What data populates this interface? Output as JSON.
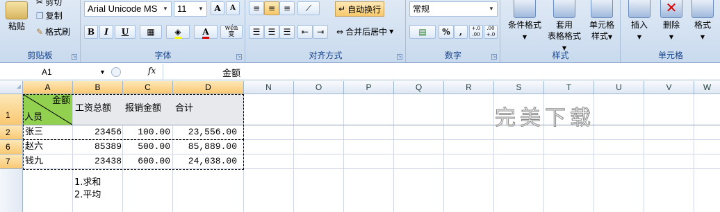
{
  "ribbon": {
    "clipboard": {
      "paste": "粘贴",
      "cut": "剪切",
      "copy": "复制",
      "format_painter": "格式刷",
      "label": "剪贴板"
    },
    "font": {
      "font_name": "Arial Unicode MS",
      "font_size": "11",
      "grow": "A",
      "shrink": "A",
      "bold": "B",
      "italic": "I",
      "underline": "U",
      "font_color_letter": "A",
      "phonetic": "wén",
      "phonetic_char": "变",
      "label": "字体"
    },
    "alignment": {
      "wrap_text": "自动换行",
      "merge_center": "合并后居中",
      "label": "对齐方式"
    },
    "number": {
      "format": "常规",
      "percent": "%",
      "comma": ",",
      "inc_decimal": "+.0 .00",
      "dec_decimal": ".00 +.0",
      "label": "数字"
    },
    "styles": {
      "conditional": "条件格式",
      "table_format_1": "套用",
      "table_format_2": "表格格式",
      "cell_styles_1": "单元格",
      "cell_styles_2": "样式",
      "label": "样式"
    },
    "cells": {
      "insert": "插入",
      "delete": "删除",
      "format": "格式",
      "label": "单元格"
    }
  },
  "formula_bar": {
    "name_box": "A1",
    "fx": "fx",
    "content": "金额"
  },
  "columns": [
    "A",
    "B",
    "C",
    "D",
    "N",
    "O",
    "P",
    "Q",
    "R",
    "S",
    "T",
    "U",
    "V",
    "W"
  ],
  "rows": [
    "1",
    "2",
    "6",
    "7",
    ""
  ],
  "table": {
    "a1_top": "金额",
    "a1_bottom": "人员",
    "headers": [
      "工资总额",
      "报销金额",
      "合计"
    ],
    "data": [
      {
        "name": "张三",
        "salary": "23456",
        "reimb": "100.00",
        "total": "23,556.00"
      },
      {
        "name": "赵六",
        "salary": "85389",
        "reimb": "500.00",
        "total": "85,889.00"
      },
      {
        "name": "钱九",
        "salary": "23438",
        "reimb": "600.00",
        "total": "24,038.00"
      }
    ],
    "notes": [
      "1.求和",
      "2.平均"
    ]
  },
  "watermark": "完美下载"
}
